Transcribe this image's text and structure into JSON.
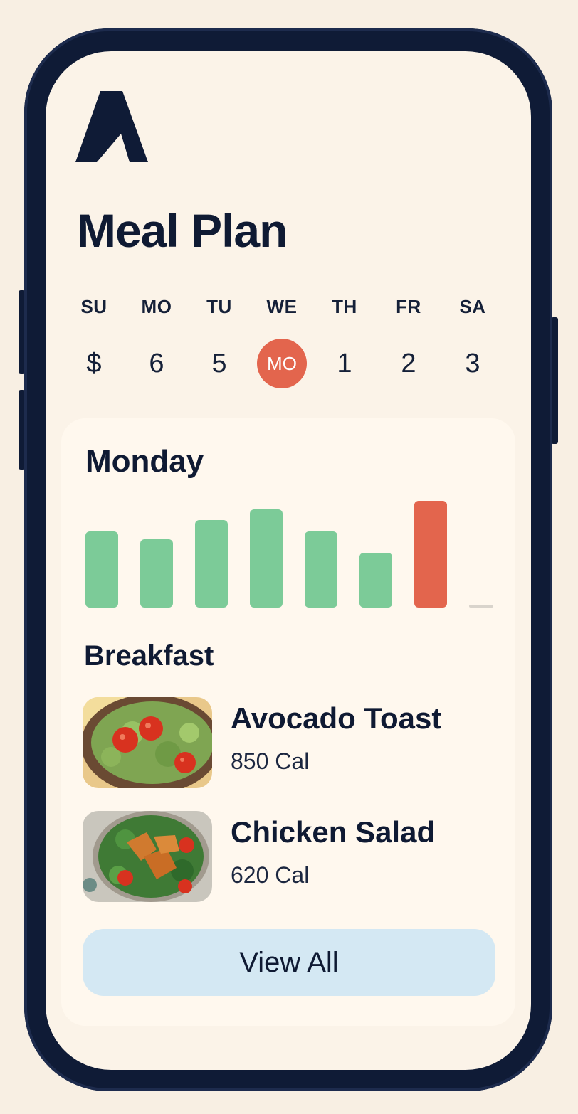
{
  "header": {
    "title": "Meal Plan",
    "logo_icon": "logo-a-icon"
  },
  "week": {
    "days": [
      {
        "label": "SU",
        "value": "$",
        "selected": false
      },
      {
        "label": "MO",
        "value": "6",
        "selected": false
      },
      {
        "label": "TU",
        "value": "5",
        "selected": false
      },
      {
        "label": "WE",
        "value": "MO",
        "selected": true
      },
      {
        "label": "TH",
        "value": "1",
        "selected": false
      },
      {
        "label": "FR",
        "value": "2",
        "selected": false
      },
      {
        "label": "SA",
        "value": "3",
        "selected": false
      }
    ]
  },
  "card": {
    "title": "Monday",
    "section_title": "Breakfast",
    "meals": [
      {
        "name": "Avocado Toast",
        "calories": "850 Cal",
        "image_icon": "avocado-toast-image"
      },
      {
        "name": "Chicken Salad",
        "calories": "620 Cal",
        "image_icon": "chicken-salad-image"
      }
    ],
    "view_all_label": "View All"
  },
  "chart_data": {
    "type": "bar",
    "values": [
      0.71,
      0.64,
      0.82,
      0.92,
      0.71,
      0.51,
      1.0,
      0
    ],
    "highlight_index": 6,
    "colors": {
      "default": "#7ccb98",
      "highlight": "#e3654d",
      "placeholder": "#d9d4cc"
    }
  },
  "colors": {
    "background": "#f8efe3",
    "frame": "#0f1b36",
    "accent": "#e3654d",
    "bar": "#7ccb98",
    "button": "#d4e8f3"
  }
}
